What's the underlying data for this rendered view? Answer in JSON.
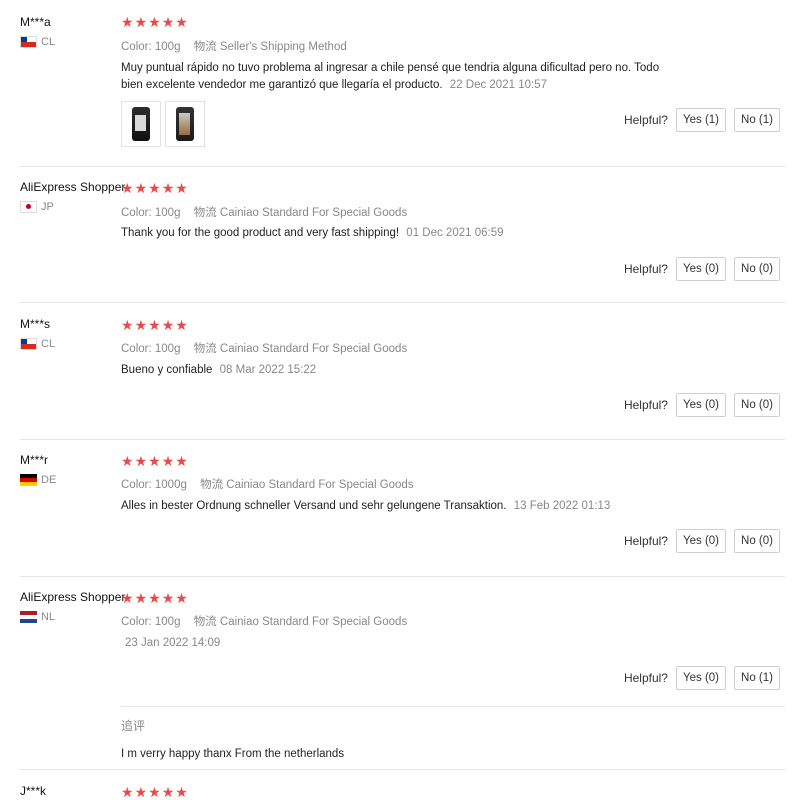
{
  "helpful_label": "Helpful?",
  "reviews": [
    {
      "user": "M***a",
      "country": "CL",
      "color_label": "Color:",
      "color_value": "100g",
      "shipping_label": "物流",
      "shipping_value": "Seller's Shipping Method",
      "text": "Muy puntual rápido no tuvo problema al ingresar a chile pensé que tendria alguna dificultad pero no. Todo bien excelente vendedor me garantizó que llegaría el producto.",
      "date": "22 Dec 2021 10:57",
      "yes": "Yes (1)",
      "no": "No (1)"
    },
    {
      "user": "AliExpress Shopper",
      "country": "JP",
      "color_label": "Color:",
      "color_value": "100g",
      "shipping_label": "物流",
      "shipping_value": "Cainiao Standard For Special Goods",
      "text": "Thank you for the good product and very fast shipping!",
      "date": "01 Dec 2021 06:59",
      "yes": "Yes (0)",
      "no": "No (0)"
    },
    {
      "user": "M***s",
      "country": "CL",
      "color_label": "Color:",
      "color_value": "100g",
      "shipping_label": "物流",
      "shipping_value": "Cainiao Standard For Special Goods",
      "text": "Bueno y confiable",
      "date": "08 Mar 2022 15:22",
      "yes": "Yes (0)",
      "no": "No (0)"
    },
    {
      "user": "M***r",
      "country": "DE",
      "color_label": "Color:",
      "color_value": "1000g",
      "shipping_label": "物流",
      "shipping_value": "Cainiao Standard For Special Goods",
      "text": "Alles in bester Ordnung schneller Versand und sehr gelungene Transaktion.",
      "date": "13 Feb 2022 01:13",
      "yes": "Yes (0)",
      "no": "No (0)"
    },
    {
      "user": "AliExpress Shopper",
      "country": "NL",
      "color_label": "Color:",
      "color_value": "100g",
      "shipping_label": "物流",
      "shipping_value": "Cainiao Standard For Special Goods",
      "text": "",
      "date": "23 Jan 2022 14:09",
      "yes": "Yes (0)",
      "no": "No (1)",
      "followup_label": "追评",
      "followup_text": "I m verry happy thanx From the netherlands"
    },
    {
      "user": "J***k"
    }
  ],
  "colors": {
    "star": "#e94b4b",
    "muted": "#888888",
    "divider": "#e6e6e6"
  }
}
